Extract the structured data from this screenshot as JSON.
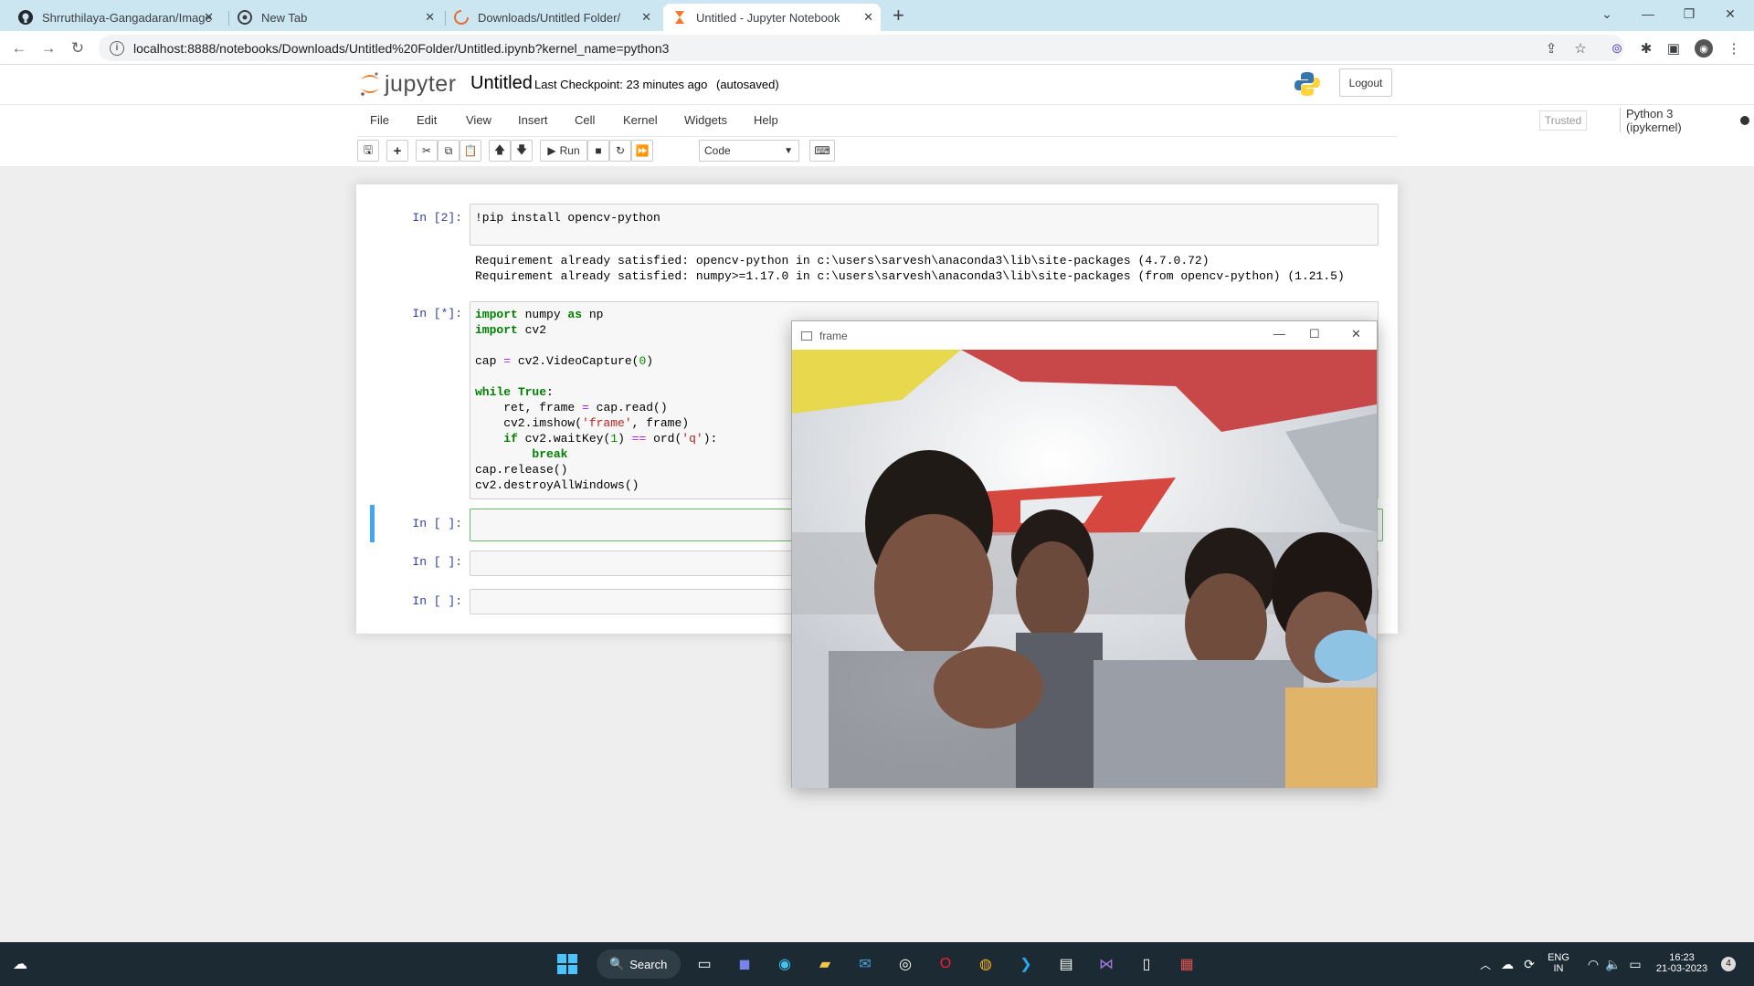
{
  "browser": {
    "tabs": [
      {
        "title": "Shrruthilaya-Gangadaran/Image",
        "icon": "github-icon"
      },
      {
        "title": "New Tab",
        "icon": "chrome-icon"
      },
      {
        "title": "Downloads/Untitled Folder/",
        "icon": "loading-icon"
      },
      {
        "title": "Untitled - Jupyter Notebook",
        "icon": "jupyter-icon",
        "active": true
      }
    ],
    "url": "localhost:8888/notebooks/Downloads/Untitled%20Folder/Untitled.ipynb?kernel_name=python3"
  },
  "jupyter": {
    "logo_text": "jupyter",
    "notebook_name": "Untitled",
    "checkpoint": "Last Checkpoint: 23 minutes ago",
    "autosave": "(autosaved)",
    "logout_label": "Logout",
    "menu": [
      "File",
      "Edit",
      "View",
      "Insert",
      "Cell",
      "Kernel",
      "Widgets",
      "Help"
    ],
    "trusted": "Trusted",
    "kernel": "Python 3 (ipykernel)",
    "run_label": "Run",
    "cell_type": "Code"
  },
  "cells": [
    {
      "prompt": "In [2]:",
      "code": "!pip install opencv-python",
      "output": [
        "Requirement already satisfied: opencv-python in c:\\users\\sarvesh\\anaconda3\\lib\\site-packages (4.7.0.72)",
        "Requirement already satisfied: numpy>=1.17.0 in c:\\users\\sarvesh\\anaconda3\\lib\\site-packages (from opencv-python) (1.21.5)"
      ]
    },
    {
      "prompt": "In [*]:",
      "code_lines": [
        "import numpy as np",
        "import cv2",
        "",
        "cap = cv2.VideoCapture(0)",
        "",
        "while True:",
        "    ret, frame = cap.read()",
        "    cv2.imshow('frame', frame)",
        "    if cv2.waitKey(1) == ord('q'):",
        "        break",
        "cap.release()",
        "cv2.destroyAllWindows()"
      ]
    },
    {
      "prompt": "In [ ]:"
    },
    {
      "prompt": "In [ ]:"
    },
    {
      "prompt": "In [ ]:"
    }
  ],
  "frame_window": {
    "title": "frame"
  },
  "taskbar": {
    "search_label": "Search",
    "lang": "ENG",
    "region": "IN",
    "time": "16:23",
    "date": "21-03-2023",
    "notifications": "4"
  }
}
